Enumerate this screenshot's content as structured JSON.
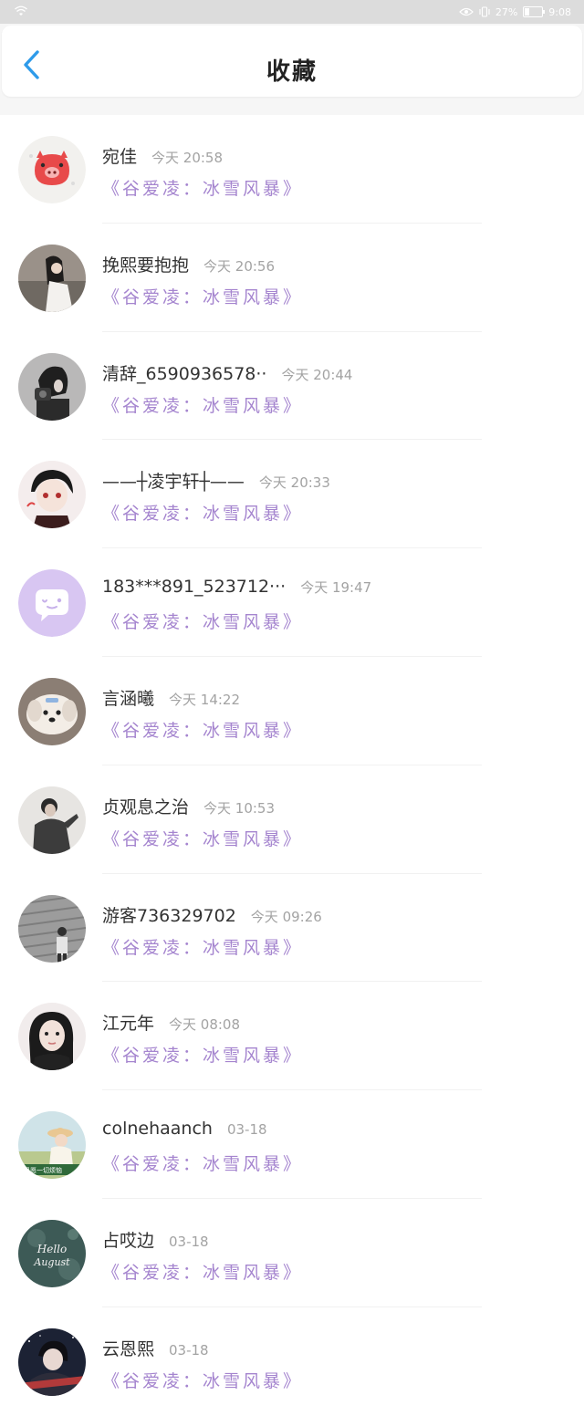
{
  "status_bar": {
    "battery_text": "27%",
    "battery_level": 0.27,
    "time": "9:08"
  },
  "header": {
    "title": "收藏",
    "back_icon": "chevron-left-icon",
    "accent": "#2e9bea"
  },
  "quote_color": "#a585cf",
  "items": [
    {
      "name": "宛佳",
      "time": "今天 20:58",
      "quote": "《谷爱凌：冰雪风暴》",
      "avatar": "pink-pig-avatar"
    },
    {
      "name": "挽熙要抱抱",
      "time": "今天 20:56",
      "quote": "《谷爱凌：冰雪风暴》",
      "avatar": "girl-photo-avatar"
    },
    {
      "name": "清辞_6590936578··",
      "time": "今天 20:44",
      "quote": "《谷爱凌：冰雪风暴》",
      "avatar": "girl-camera-avatar"
    },
    {
      "name": "——┼凌宇轩┼——",
      "time": "今天 20:33",
      "quote": "《谷爱凌：冰雪风暴》",
      "avatar": "anime-boy-avatar"
    },
    {
      "name": "183***891_523712···",
      "time": "今天 19:47",
      "quote": "《谷爱凌：冰雪风暴》",
      "avatar": "purple-chat-avatar"
    },
    {
      "name": "言涵曦",
      "time": "今天 14:22",
      "quote": "《谷爱凌：冰雪风暴》",
      "avatar": "puppy-avatar"
    },
    {
      "name": "贞观息之治",
      "time": "今天 10:53",
      "quote": "《谷爱凌：冰雪风暴》",
      "avatar": "boy-photo-avatar"
    },
    {
      "name": "游客736329702",
      "time": "今天 09:26",
      "quote": "《谷爱凌：冰雪风暴》",
      "avatar": "grey-photo-avatar"
    },
    {
      "name": "江元年",
      "time": "今天 08:08",
      "quote": "《谷爱凌：冰雪风暴》",
      "avatar": "girl-portrait-avatar"
    },
    {
      "name": "colnehaanch",
      "time": "03-18",
      "quote": "《谷爱凌：冰雪风暴》",
      "avatar": "girl-hat-avatar"
    },
    {
      "name": "占哎边",
      "time": "03-18",
      "quote": "《谷爱凌：冰雪风暴》",
      "avatar": "hello-august-avatar"
    },
    {
      "name": "云恩熙",
      "time": "03-18",
      "quote": "《谷爱凌：冰雪风暴》",
      "avatar": "night-anime-avatar"
    }
  ]
}
